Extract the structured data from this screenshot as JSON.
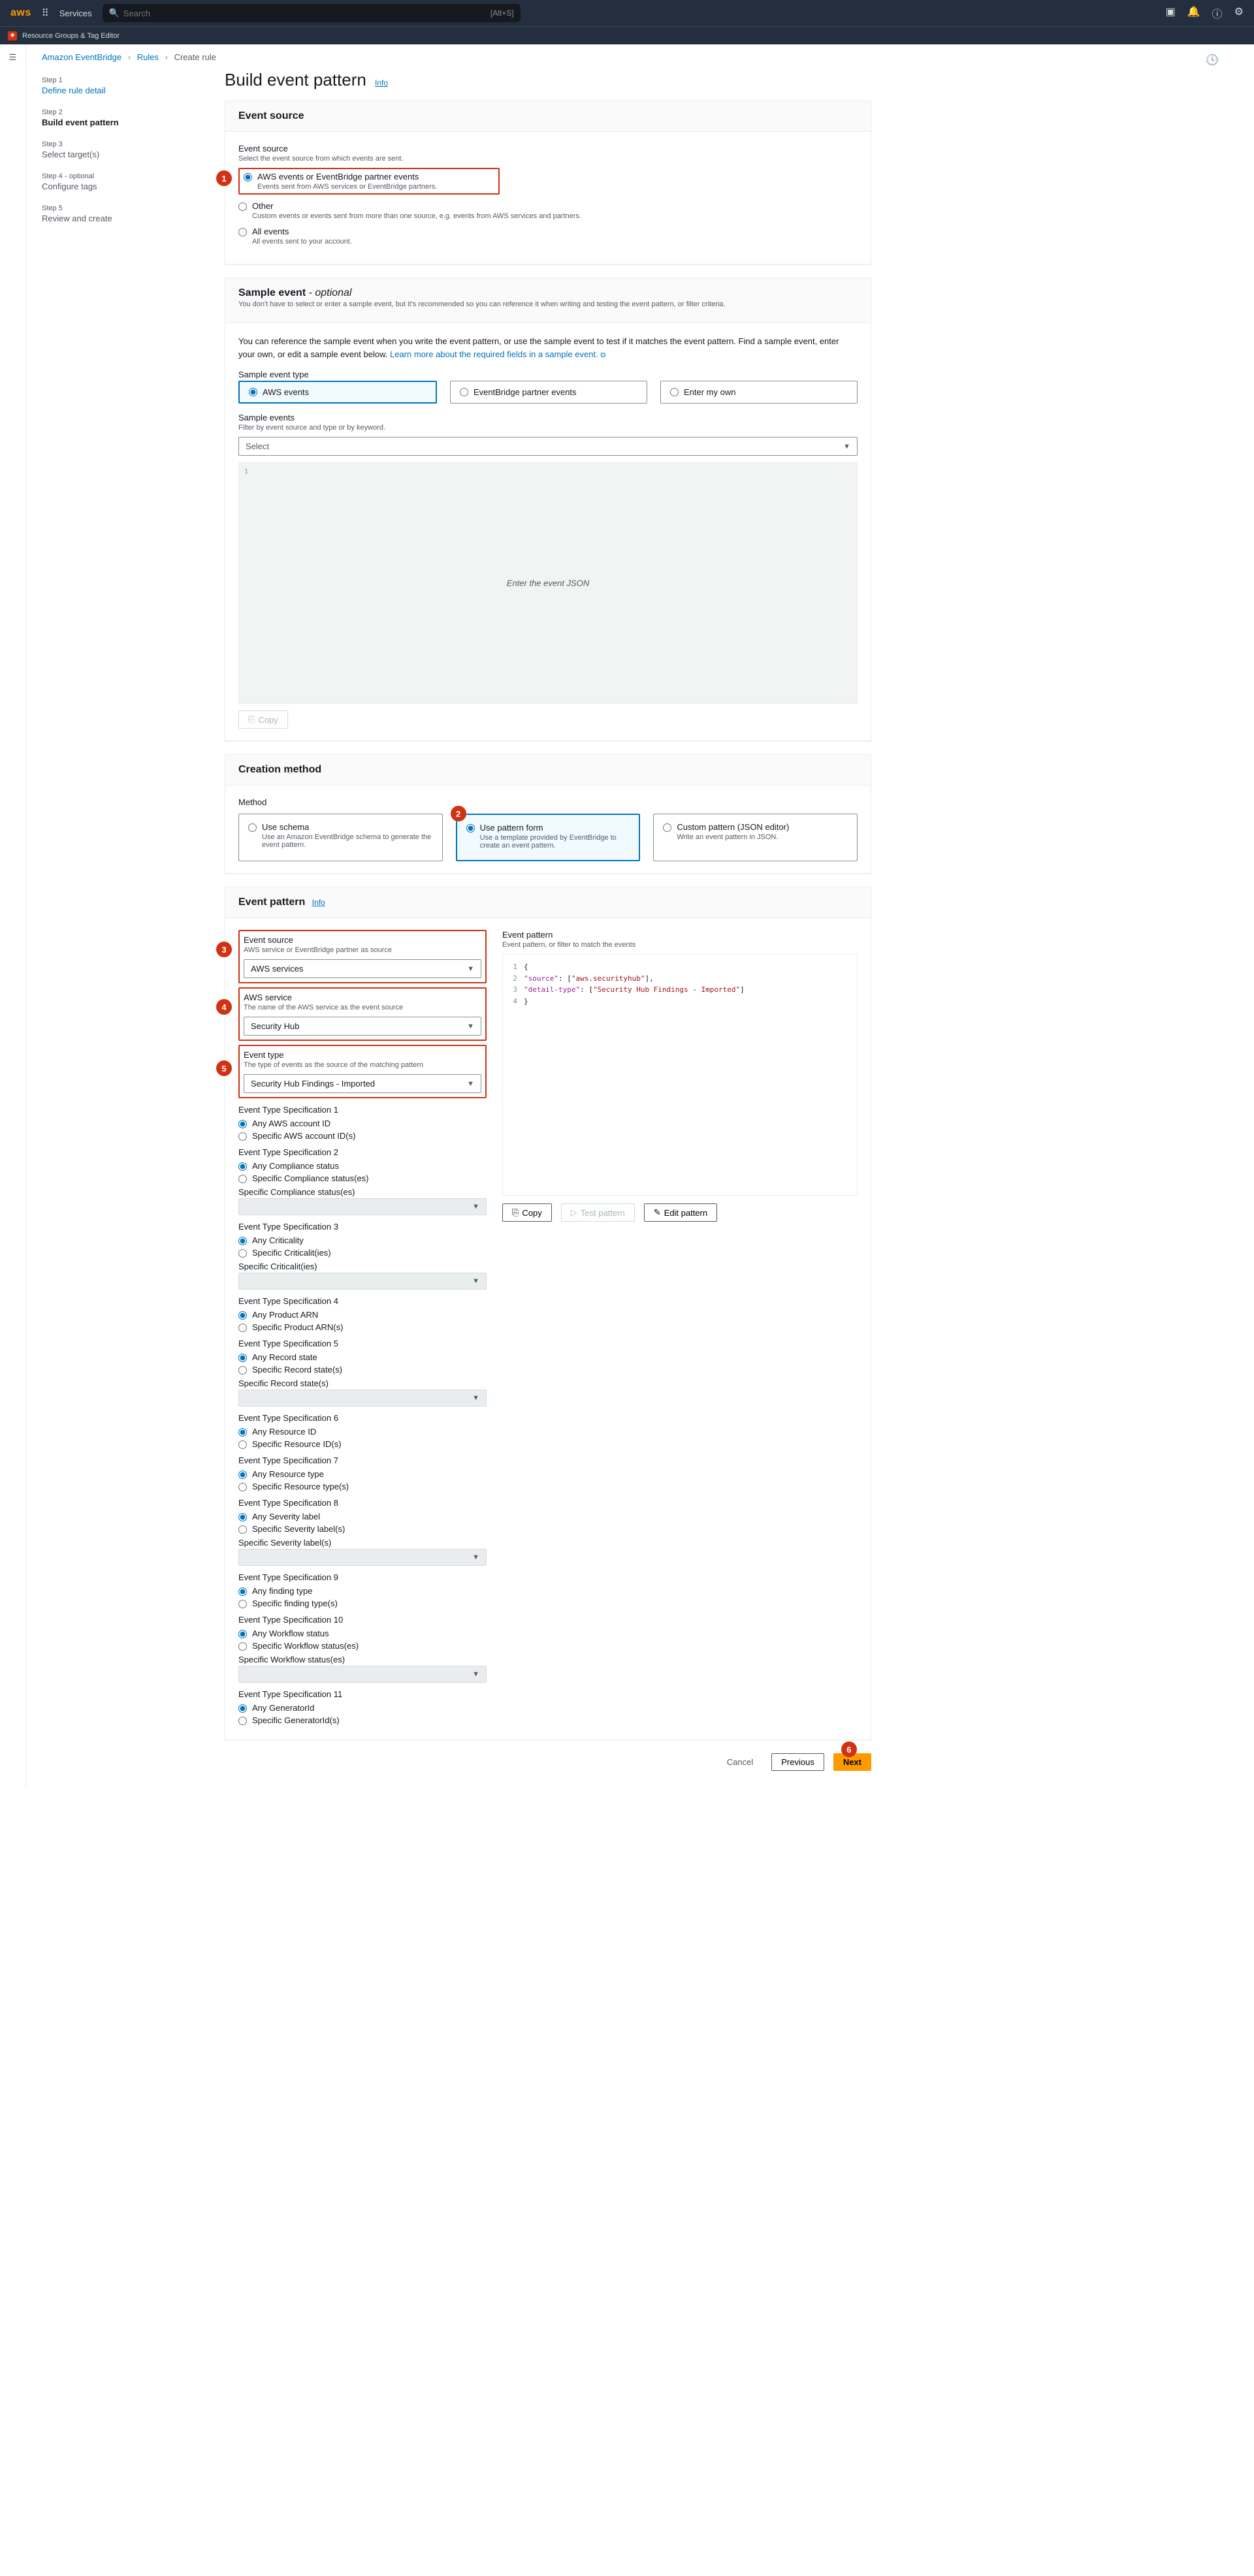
{
  "nav": {
    "logo": "aws",
    "services": "Services",
    "search_placeholder": "Search",
    "search_hint": "[Alt+S]",
    "subnav": "Resource Groups & Tag Editor"
  },
  "breadcrumb": {
    "a": "Amazon EventBridge",
    "b": "Rules",
    "c": "Create rule"
  },
  "steps": [
    {
      "num": "Step 1",
      "title": "Define rule detail"
    },
    {
      "num": "Step 2",
      "title": "Build event pattern"
    },
    {
      "num": "Step 3",
      "title": "Select target(s)"
    },
    {
      "num": "Step 4 - optional",
      "title": "Configure tags"
    },
    {
      "num": "Step 5",
      "title": "Review and create"
    }
  ],
  "page_title": "Build event pattern",
  "info_link": "Info",
  "event_source": {
    "header": "Event source",
    "label": "Event source",
    "desc": "Select the event source from which events are sent.",
    "options": [
      {
        "title": "AWS events or EventBridge partner events",
        "sub": "Events sent from AWS services or EventBridge partners."
      },
      {
        "title": "Other",
        "sub": "Custom events or events sent from more than one source, e.g. events from AWS services and partners."
      },
      {
        "title": "All events",
        "sub": "All events sent to your account."
      }
    ]
  },
  "sample_event": {
    "header": "Sample event",
    "optional": "- optional",
    "sub": "You don't have to select or enter a sample event, but it's recommended so you can reference it when writing and testing the event pattern, or filter criteria.",
    "info": "You can reference the sample event when you write the event pattern, or use the sample event to test if it matches the event pattern. Find a sample event, enter your own, or edit a sample event below.",
    "learn_link": "Learn more about the required fields in a sample event.",
    "type_label": "Sample event type",
    "types": [
      "AWS events",
      "EventBridge partner events",
      "Enter my own"
    ],
    "events_label": "Sample events",
    "events_desc": "Filter by event source and type or by keyword.",
    "select_placeholder": "Select",
    "json_placeholder": "Enter the event JSON",
    "copy": "Copy"
  },
  "creation": {
    "header": "Creation method",
    "label": "Method",
    "options": [
      {
        "title": "Use schema",
        "sub": "Use an Amazon EventBridge schema to generate the event pattern."
      },
      {
        "title": "Use pattern form",
        "sub": "Use a template provided by EventBridge to create an event pattern."
      },
      {
        "title": "Custom pattern (JSON editor)",
        "sub": "Write an event pattern in JSON."
      }
    ]
  },
  "event_pattern": {
    "header": "Event pattern",
    "info": "Info",
    "src_label": "Event source",
    "src_desc": "AWS service or EventBridge partner as source",
    "src_value": "AWS services",
    "svc_label": "AWS service",
    "svc_desc": "The name of the AWS service as the event source",
    "svc_value": "Security Hub",
    "type_label": "Event type",
    "type_desc": "The type of events as the source of the matching pattern",
    "type_value": "Security Hub Findings - Imported",
    "pattern_label": "Event pattern",
    "pattern_desc": "Event pattern, or filter to match the events",
    "json_lines": [
      {
        "n": "1",
        "t": "{"
      },
      {
        "n": "2",
        "t": "  \"source\": [\"aws.securityhub\"],"
      },
      {
        "n": "3",
        "t": "  \"detail-type\": [\"Security Hub Findings - Imported\"]"
      },
      {
        "n": "4",
        "t": "}"
      }
    ],
    "copy": "Copy",
    "test": "Test pattern",
    "edit": "Edit pattern",
    "specs": [
      {
        "title": "Event Type Specification 1",
        "any": "Any AWS account ID",
        "spec": "Specific AWS account ID(s)",
        "has_multi": false
      },
      {
        "title": "Event Type Specification 2",
        "any": "Any Compliance status",
        "spec": "Specific Compliance status(es)",
        "has_multi": true,
        "multi_label": "Specific Compliance status(es)"
      },
      {
        "title": "Event Type Specification 3",
        "any": "Any Criticality",
        "spec": "Specific Criticalit(ies)",
        "has_multi": true,
        "multi_label": "Specific Criticalit(ies)"
      },
      {
        "title": "Event Type Specification 4",
        "any": "Any Product ARN",
        "spec": "Specific Product ARN(s)",
        "has_multi": false
      },
      {
        "title": "Event Type Specification 5",
        "any": "Any Record state",
        "spec": "Specific Record state(s)",
        "has_multi": true,
        "multi_label": "Specific Record state(s)"
      },
      {
        "title": "Event Type Specification 6",
        "any": "Any Resource ID",
        "spec": "Specific Resource ID(s)",
        "has_multi": false
      },
      {
        "title": "Event Type Specification 7",
        "any": "Any Resource type",
        "spec": "Specific Resource type(s)",
        "has_multi": false
      },
      {
        "title": "Event Type Specification 8",
        "any": "Any Severity label",
        "spec": "Specific Severity label(s)",
        "has_multi": true,
        "multi_label": "Specific Severity label(s)"
      },
      {
        "title": "Event Type Specification 9",
        "any": "Any finding type",
        "spec": "Specific finding type(s)",
        "has_multi": false
      },
      {
        "title": "Event Type Specification 10",
        "any": "Any Workflow status",
        "spec": "Specific Workflow status(es)",
        "has_multi": true,
        "multi_label": "Specific Workflow status(es)"
      },
      {
        "title": "Event Type Specification 11",
        "any": "Any GeneratorId",
        "spec": "Specific GeneratorId(s)",
        "has_multi": false
      }
    ]
  },
  "footer": {
    "cancel": "Cancel",
    "previous": "Previous",
    "next": "Next"
  },
  "annotations": [
    "1",
    "2",
    "3",
    "4",
    "5",
    "6"
  ]
}
